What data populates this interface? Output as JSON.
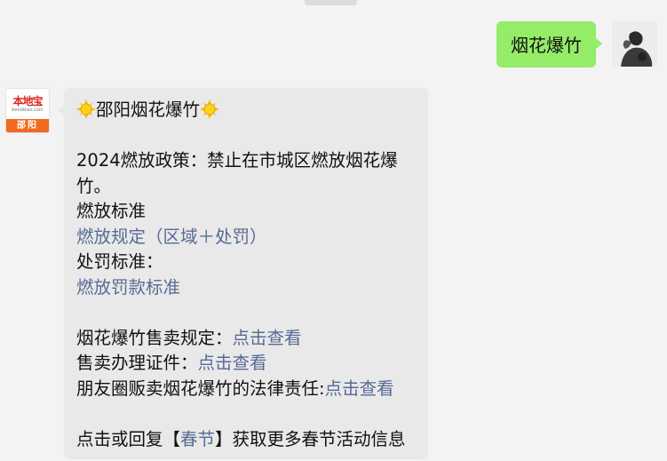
{
  "sent_message": {
    "text": "烟花爆竹"
  },
  "sender": {
    "brand_logo": "本地宝",
    "brand_domain": "bendibao.com",
    "brand_city": "邵阳"
  },
  "reply": {
    "title": "邵阳烟花爆竹",
    "policy_line": "2024燃放政策：禁止在市城区燃放烟花爆竹。",
    "burn_standard_label": "燃放标准",
    "burn_rules_link": "燃放规定（区域＋处罚）",
    "penalty_label": "处罚标准：",
    "penalty_link": "燃放罚款标准",
    "sale_rules_label": "烟花爆竹售卖规定：",
    "sale_rules_link": "点击查看",
    "sale_docs_label": "售卖办理证件：",
    "sale_docs_link": "点击查看",
    "moments_label": "朋友圈贩卖烟花爆竹的法律责任:",
    "moments_link": "点击查看",
    "footer_prefix": "点击或回复【",
    "footer_link": "春节",
    "footer_suffix": "】获取更多春节活动信息"
  },
  "icons": {
    "sun_emoji": "sun-emoji-icon"
  },
  "colors": {
    "background": "#f3f3f3",
    "sent_bubble": "#95ec69",
    "received_bubble": "#e9e9e9",
    "link": "#576b95",
    "brand_red": "#d9261c",
    "brand_orange": "#ee6b1f"
  }
}
